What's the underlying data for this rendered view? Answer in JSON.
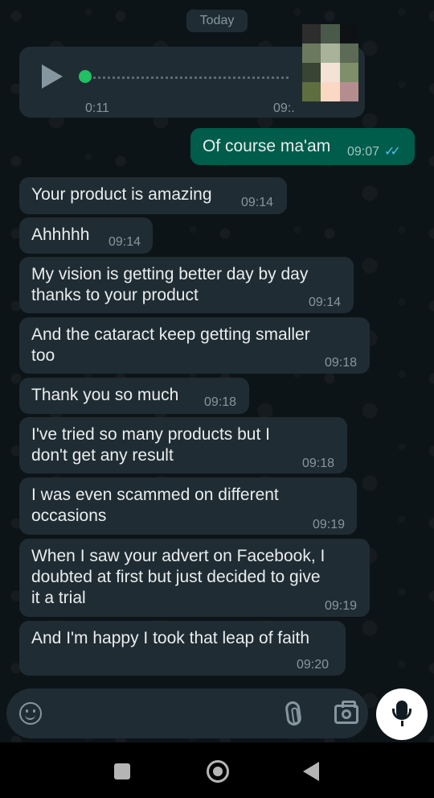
{
  "date_chip": "Today",
  "voice_message": {
    "duration": "0:11",
    "time": "09:."
  },
  "outgoing": [
    {
      "text": "Of course ma'am",
      "time": "09:07"
    }
  ],
  "messages": [
    {
      "text": "Your product is amazing",
      "time": "09:14"
    },
    {
      "text": "Ahhhhh",
      "time": "09:14"
    },
    {
      "text": "My vision is getting better day by day thanks to your product",
      "time": "09:14"
    },
    {
      "text": "And the cataract keep getting smaller too",
      "time": "09:18"
    },
    {
      "text": "Thank you so much",
      "time": "09:18"
    },
    {
      "text": "I've tried so many products but I don't get any result",
      "time": "09:18"
    },
    {
      "text": "I was even scammed on different occasions",
      "time": "09:19"
    },
    {
      "text": "When I saw your advert on Facebook, I doubted at first but just decided to give it a trial",
      "time": "09:19"
    },
    {
      "text": "And I'm happy I took that leap of faith",
      "time": "09:20"
    }
  ],
  "icons": {
    "play": "play-icon",
    "sticker": "sticker-icon",
    "attach": "paperclip-icon",
    "camera": "camera-icon",
    "mic": "mic-icon",
    "read_receipt": "double-check-icon"
  },
  "colors": {
    "background": "#0b141a",
    "incoming_bubble": "#202c33",
    "outgoing_bubble": "#005c4b",
    "read_check": "#53bdeb",
    "progress_dot": "#21c063"
  }
}
